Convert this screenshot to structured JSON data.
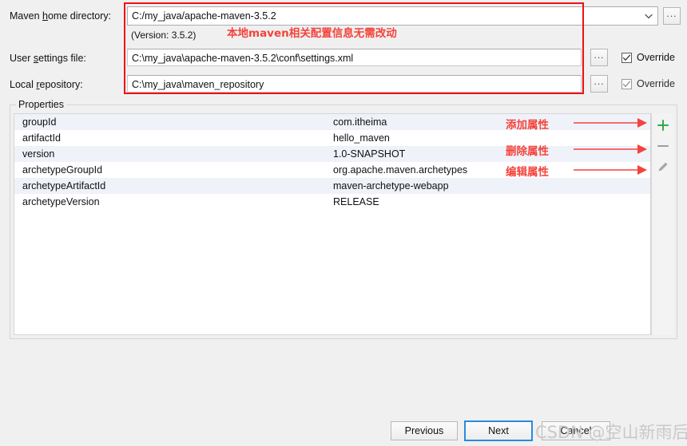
{
  "dialog": {
    "fields": [
      {
        "label_prefix": "Maven ",
        "label_mnemonic": "h",
        "label_suffix": "ome directory:",
        "value": "C:/my_java/apache-maven-3.5.2",
        "browse_label": "...",
        "version_note": "(Version: 3.5.2)"
      },
      {
        "label_prefix": "User ",
        "label_mnemonic": "s",
        "label_suffix": "ettings file:",
        "value": "C:\\my_java\\apache-maven-3.5.2\\conf\\settings.xml",
        "browse_label": "...",
        "override_label": "Override",
        "override_checked": true
      },
      {
        "label_prefix": "Local ",
        "label_mnemonic": "r",
        "label_suffix": "epository:",
        "value": "C:\\my_java\\maven_repository",
        "browse_label": "...",
        "override_label": "Override",
        "override_checked": true
      }
    ]
  },
  "properties": {
    "group_title": "Properties",
    "rows": [
      {
        "key": "groupId",
        "value": "com.itheima"
      },
      {
        "key": "artifactId",
        "value": "hello_maven"
      },
      {
        "key": "version",
        "value": "1.0-SNAPSHOT"
      },
      {
        "key": "archetypeGroupId",
        "value": "org.apache.maven.archetypes"
      },
      {
        "key": "archetypeArtifactId",
        "value": "maven-archetype-webapp"
      },
      {
        "key": "archetypeVersion",
        "value": "RELEASE"
      }
    ],
    "toolbar": {
      "add_icon": "plus-icon",
      "remove_icon": "minus-icon",
      "edit_icon": "pencil-icon",
      "add_color": "#2faa4b",
      "remove_color": "#9e9e9e",
      "edit_color": "#9e9e9e"
    }
  },
  "annotations": {
    "box_note": "本地maven相关配置信息无需改动",
    "add_note": "添加属性",
    "remove_note": "删除属性",
    "edit_note": "编辑属性",
    "color": "#f4433c"
  },
  "buttons": {
    "previous": "Previous",
    "next": "Next",
    "cancel": "Cancel"
  },
  "watermark": {
    "text": "CSDN @空山新雨后~"
  }
}
